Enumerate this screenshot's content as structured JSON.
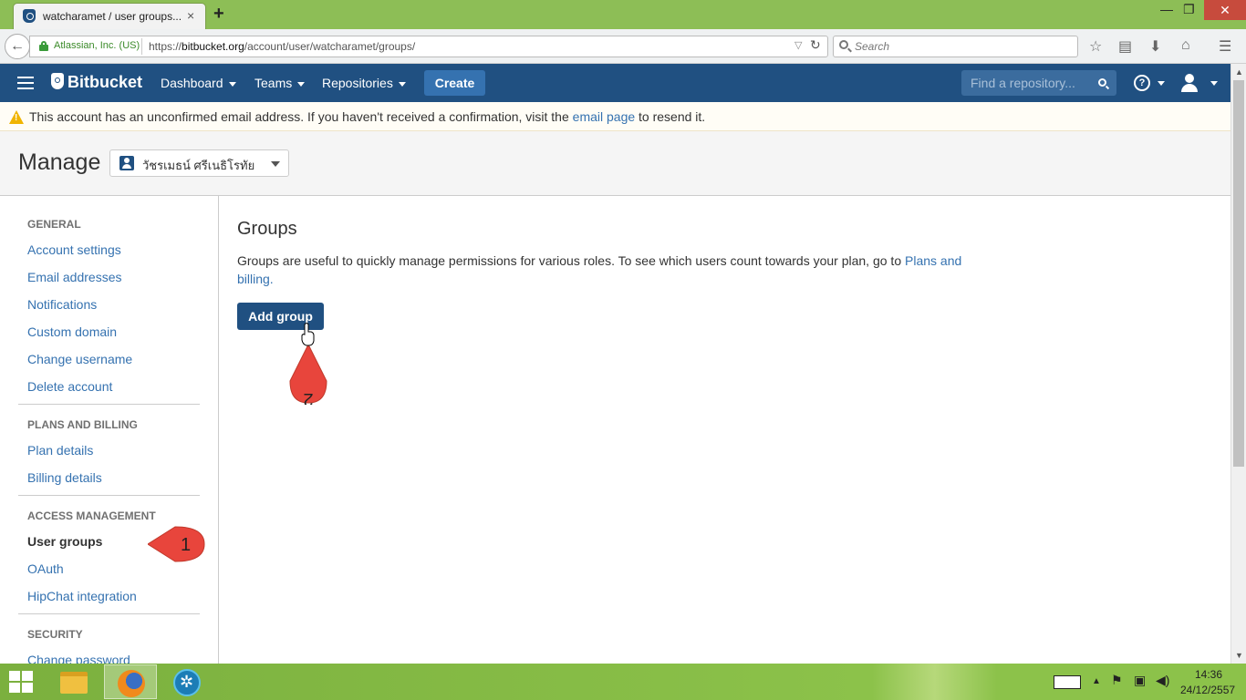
{
  "browser": {
    "tab_title": "watcharamet / user groups...",
    "tab_close": "×",
    "new_tab": "+",
    "site_identity": "Atlassian, Inc. (US)",
    "url_prefix": "https://",
    "url_host": "bitbucket.org",
    "url_path": "/account/user/watcharamet/groups/",
    "search_placeholder": "Search",
    "window_minimize": "—",
    "window_restore": "❐",
    "window_close": "✕"
  },
  "bitbucket": {
    "brand": "Bitbucket",
    "menu": {
      "dashboard": "Dashboard",
      "teams": "Teams",
      "repositories": "Repositories"
    },
    "create": "Create",
    "search_placeholder": "Find a repository...",
    "help_glyph": "?"
  },
  "warning": {
    "text_before": "This account has an unconfirmed email address. If you haven't received a confirmation, visit the ",
    "link": "email page",
    "text_after": " to resend it."
  },
  "manage": {
    "title": "Manage",
    "account_name": "วัชรเมธน์ ศรีเนธิโรทัย"
  },
  "sidebar": {
    "general_heading": "GENERAL",
    "general_items": [
      "Account settings",
      "Email addresses",
      "Notifications",
      "Custom domain",
      "Change username",
      "Delete account"
    ],
    "plans_heading": "PLANS AND BILLING",
    "plans_items": [
      "Plan details",
      "Billing details"
    ],
    "access_heading": "ACCESS MANAGEMENT",
    "access_items": [
      "User groups",
      "OAuth",
      "HipChat integration"
    ],
    "security_heading": "SECURITY",
    "security_items": [
      "Change password"
    ]
  },
  "main": {
    "title": "Groups",
    "description_before": "Groups are useful to quickly manage permissions for various roles. To see which users count towards your plan, go to ",
    "description_link": "Plans and billing.",
    "add_group": "Add group"
  },
  "annotations": {
    "marker_1": "1",
    "marker_2": "2"
  },
  "taskbar": {
    "time": "14:36",
    "date": "24/12/2557"
  },
  "colors": {
    "header_bg": "#205081",
    "link": "#3572b0",
    "tab_strip": "#8dbe56",
    "marker": "#e8453c"
  }
}
